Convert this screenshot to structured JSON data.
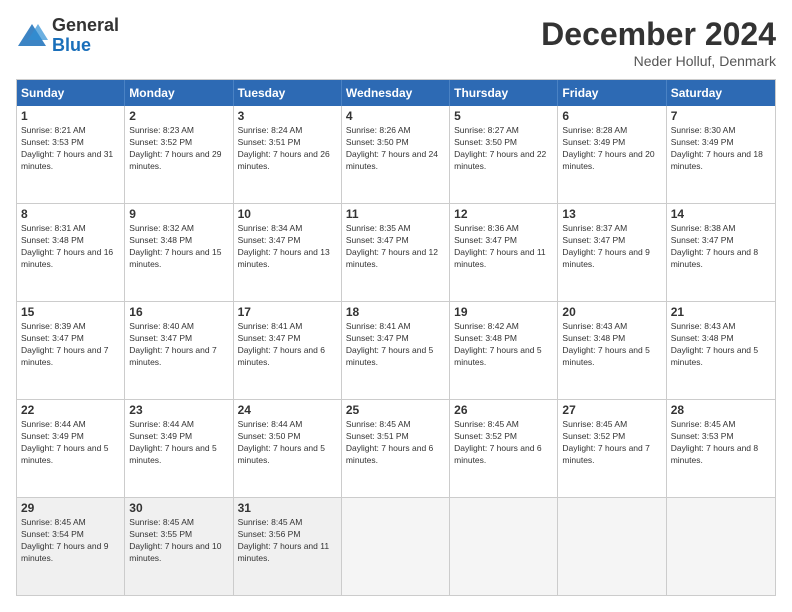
{
  "header": {
    "logo_general": "General",
    "logo_blue": "Blue",
    "month_title": "December 2024",
    "location": "Neder Holluf, Denmark"
  },
  "days_of_week": [
    "Sunday",
    "Monday",
    "Tuesday",
    "Wednesday",
    "Thursday",
    "Friday",
    "Saturday"
  ],
  "rows": [
    [
      {
        "day": "1",
        "sunrise": "Sunrise: 8:21 AM",
        "sunset": "Sunset: 3:53 PM",
        "daylight": "Daylight: 7 hours and 31 minutes.",
        "empty": false
      },
      {
        "day": "2",
        "sunrise": "Sunrise: 8:23 AM",
        "sunset": "Sunset: 3:52 PM",
        "daylight": "Daylight: 7 hours and 29 minutes.",
        "empty": false
      },
      {
        "day": "3",
        "sunrise": "Sunrise: 8:24 AM",
        "sunset": "Sunset: 3:51 PM",
        "daylight": "Daylight: 7 hours and 26 minutes.",
        "empty": false
      },
      {
        "day": "4",
        "sunrise": "Sunrise: 8:26 AM",
        "sunset": "Sunset: 3:50 PM",
        "daylight": "Daylight: 7 hours and 24 minutes.",
        "empty": false
      },
      {
        "day": "5",
        "sunrise": "Sunrise: 8:27 AM",
        "sunset": "Sunset: 3:50 PM",
        "daylight": "Daylight: 7 hours and 22 minutes.",
        "empty": false
      },
      {
        "day": "6",
        "sunrise": "Sunrise: 8:28 AM",
        "sunset": "Sunset: 3:49 PM",
        "daylight": "Daylight: 7 hours and 20 minutes.",
        "empty": false
      },
      {
        "day": "7",
        "sunrise": "Sunrise: 8:30 AM",
        "sunset": "Sunset: 3:49 PM",
        "daylight": "Daylight: 7 hours and 18 minutes.",
        "empty": false
      }
    ],
    [
      {
        "day": "8",
        "sunrise": "Sunrise: 8:31 AM",
        "sunset": "Sunset: 3:48 PM",
        "daylight": "Daylight: 7 hours and 16 minutes.",
        "empty": false
      },
      {
        "day": "9",
        "sunrise": "Sunrise: 8:32 AM",
        "sunset": "Sunset: 3:48 PM",
        "daylight": "Daylight: 7 hours and 15 minutes.",
        "empty": false
      },
      {
        "day": "10",
        "sunrise": "Sunrise: 8:34 AM",
        "sunset": "Sunset: 3:47 PM",
        "daylight": "Daylight: 7 hours and 13 minutes.",
        "empty": false
      },
      {
        "day": "11",
        "sunrise": "Sunrise: 8:35 AM",
        "sunset": "Sunset: 3:47 PM",
        "daylight": "Daylight: 7 hours and 12 minutes.",
        "empty": false
      },
      {
        "day": "12",
        "sunrise": "Sunrise: 8:36 AM",
        "sunset": "Sunset: 3:47 PM",
        "daylight": "Daylight: 7 hours and 11 minutes.",
        "empty": false
      },
      {
        "day": "13",
        "sunrise": "Sunrise: 8:37 AM",
        "sunset": "Sunset: 3:47 PM",
        "daylight": "Daylight: 7 hours and 9 minutes.",
        "empty": false
      },
      {
        "day": "14",
        "sunrise": "Sunrise: 8:38 AM",
        "sunset": "Sunset: 3:47 PM",
        "daylight": "Daylight: 7 hours and 8 minutes.",
        "empty": false
      }
    ],
    [
      {
        "day": "15",
        "sunrise": "Sunrise: 8:39 AM",
        "sunset": "Sunset: 3:47 PM",
        "daylight": "Daylight: 7 hours and 7 minutes.",
        "empty": false
      },
      {
        "day": "16",
        "sunrise": "Sunrise: 8:40 AM",
        "sunset": "Sunset: 3:47 PM",
        "daylight": "Daylight: 7 hours and 7 minutes.",
        "empty": false
      },
      {
        "day": "17",
        "sunrise": "Sunrise: 8:41 AM",
        "sunset": "Sunset: 3:47 PM",
        "daylight": "Daylight: 7 hours and 6 minutes.",
        "empty": false
      },
      {
        "day": "18",
        "sunrise": "Sunrise: 8:41 AM",
        "sunset": "Sunset: 3:47 PM",
        "daylight": "Daylight: 7 hours and 5 minutes.",
        "empty": false
      },
      {
        "day": "19",
        "sunrise": "Sunrise: 8:42 AM",
        "sunset": "Sunset: 3:48 PM",
        "daylight": "Daylight: 7 hours and 5 minutes.",
        "empty": false
      },
      {
        "day": "20",
        "sunrise": "Sunrise: 8:43 AM",
        "sunset": "Sunset: 3:48 PM",
        "daylight": "Daylight: 7 hours and 5 minutes.",
        "empty": false
      },
      {
        "day": "21",
        "sunrise": "Sunrise: 8:43 AM",
        "sunset": "Sunset: 3:48 PM",
        "daylight": "Daylight: 7 hours and 5 minutes.",
        "empty": false
      }
    ],
    [
      {
        "day": "22",
        "sunrise": "Sunrise: 8:44 AM",
        "sunset": "Sunset: 3:49 PM",
        "daylight": "Daylight: 7 hours and 5 minutes.",
        "empty": false
      },
      {
        "day": "23",
        "sunrise": "Sunrise: 8:44 AM",
        "sunset": "Sunset: 3:49 PM",
        "daylight": "Daylight: 7 hours and 5 minutes.",
        "empty": false
      },
      {
        "day": "24",
        "sunrise": "Sunrise: 8:44 AM",
        "sunset": "Sunset: 3:50 PM",
        "daylight": "Daylight: 7 hours and 5 minutes.",
        "empty": false
      },
      {
        "day": "25",
        "sunrise": "Sunrise: 8:45 AM",
        "sunset": "Sunset: 3:51 PM",
        "daylight": "Daylight: 7 hours and 6 minutes.",
        "empty": false
      },
      {
        "day": "26",
        "sunrise": "Sunrise: 8:45 AM",
        "sunset": "Sunset: 3:52 PM",
        "daylight": "Daylight: 7 hours and 6 minutes.",
        "empty": false
      },
      {
        "day": "27",
        "sunrise": "Sunrise: 8:45 AM",
        "sunset": "Sunset: 3:52 PM",
        "daylight": "Daylight: 7 hours and 7 minutes.",
        "empty": false
      },
      {
        "day": "28",
        "sunrise": "Sunrise: 8:45 AM",
        "sunset": "Sunset: 3:53 PM",
        "daylight": "Daylight: 7 hours and 8 minutes.",
        "empty": false
      }
    ],
    [
      {
        "day": "29",
        "sunrise": "Sunrise: 8:45 AM",
        "sunset": "Sunset: 3:54 PM",
        "daylight": "Daylight: 7 hours and 9 minutes.",
        "empty": false
      },
      {
        "day": "30",
        "sunrise": "Sunrise: 8:45 AM",
        "sunset": "Sunset: 3:55 PM",
        "daylight": "Daylight: 7 hours and 10 minutes.",
        "empty": false
      },
      {
        "day": "31",
        "sunrise": "Sunrise: 8:45 AM",
        "sunset": "Sunset: 3:56 PM",
        "daylight": "Daylight: 7 hours and 11 minutes.",
        "empty": false
      },
      {
        "day": "",
        "sunrise": "",
        "sunset": "",
        "daylight": "",
        "empty": true
      },
      {
        "day": "",
        "sunrise": "",
        "sunset": "",
        "daylight": "",
        "empty": true
      },
      {
        "day": "",
        "sunrise": "",
        "sunset": "",
        "daylight": "",
        "empty": true
      },
      {
        "day": "",
        "sunrise": "",
        "sunset": "",
        "daylight": "",
        "empty": true
      }
    ]
  ]
}
